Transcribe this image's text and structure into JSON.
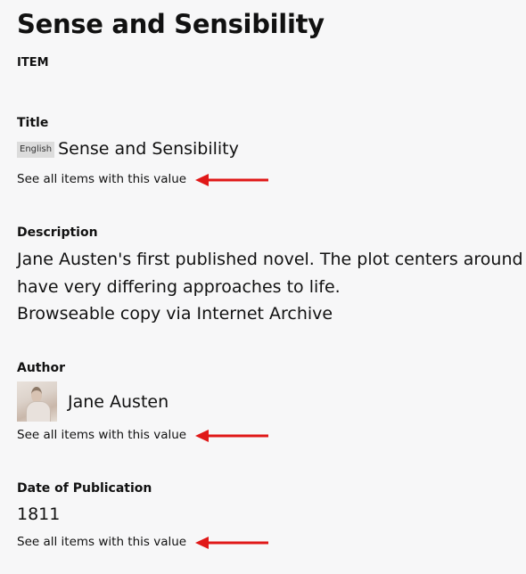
{
  "item": {
    "title": "Sense and Sensibility",
    "resource_type": "ITEM"
  },
  "properties": {
    "title": {
      "label": "Title",
      "language": "English",
      "value": "Sense and Sensibility",
      "see_all": "See all items with this value"
    },
    "description": {
      "label": "Description",
      "line1": "Jane Austen's first published novel. The plot centers around the Dashwood sisters, who",
      "line2": "have very differing approaches to life.",
      "line3": "Browseable copy via Internet Archive"
    },
    "author": {
      "label": "Author",
      "value": "Jane Austen",
      "thumbnail_icon": "portrait-thumbnail",
      "see_all": "See all items with this value"
    },
    "date_of_publication": {
      "label": "Date of Publication",
      "value": "1811",
      "see_all": "See all items with this value"
    }
  },
  "annotations": {
    "arrow_color": "#e01818"
  }
}
